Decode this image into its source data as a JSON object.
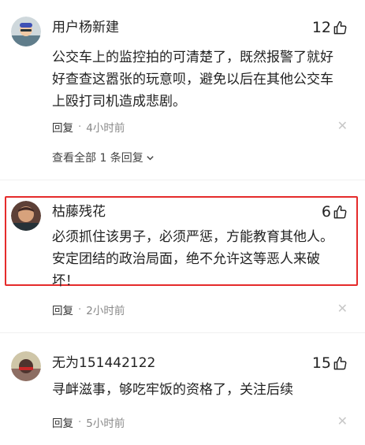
{
  "comments": [
    {
      "username": "用户杨新建",
      "likes": "12",
      "content": "公交车上的监控拍的可清楚了，既然报警了就好\n好查查这嚣张的玩意呗，避免以后在其他公交车\n上殴打司机造成悲剧。",
      "reply_label": "回复",
      "time": "4小时前"
    },
    {
      "username": "枯藤残花",
      "likes": "6",
      "content": "必须抓住该男子，必须严惩，方能教育其他人。\n安定团结的政治局面，绝不允许这等恶人来破\n坏！",
      "reply_label": "回复",
      "time": "2小时前"
    },
    {
      "username": "无为151442122",
      "likes": "15",
      "content": "寻衅滋事，够吃牢饭的资格了，关注后续",
      "reply_label": "回复",
      "time": "5小时前"
    }
  ],
  "see_all_replies": "查看全部 1 条回复",
  "icons": {
    "like": "thumbs-up-icon",
    "close": "close-icon",
    "chevron": "chevron-down-icon"
  },
  "colors": {
    "highlight": "#e52b2b",
    "muted": "#888888"
  }
}
